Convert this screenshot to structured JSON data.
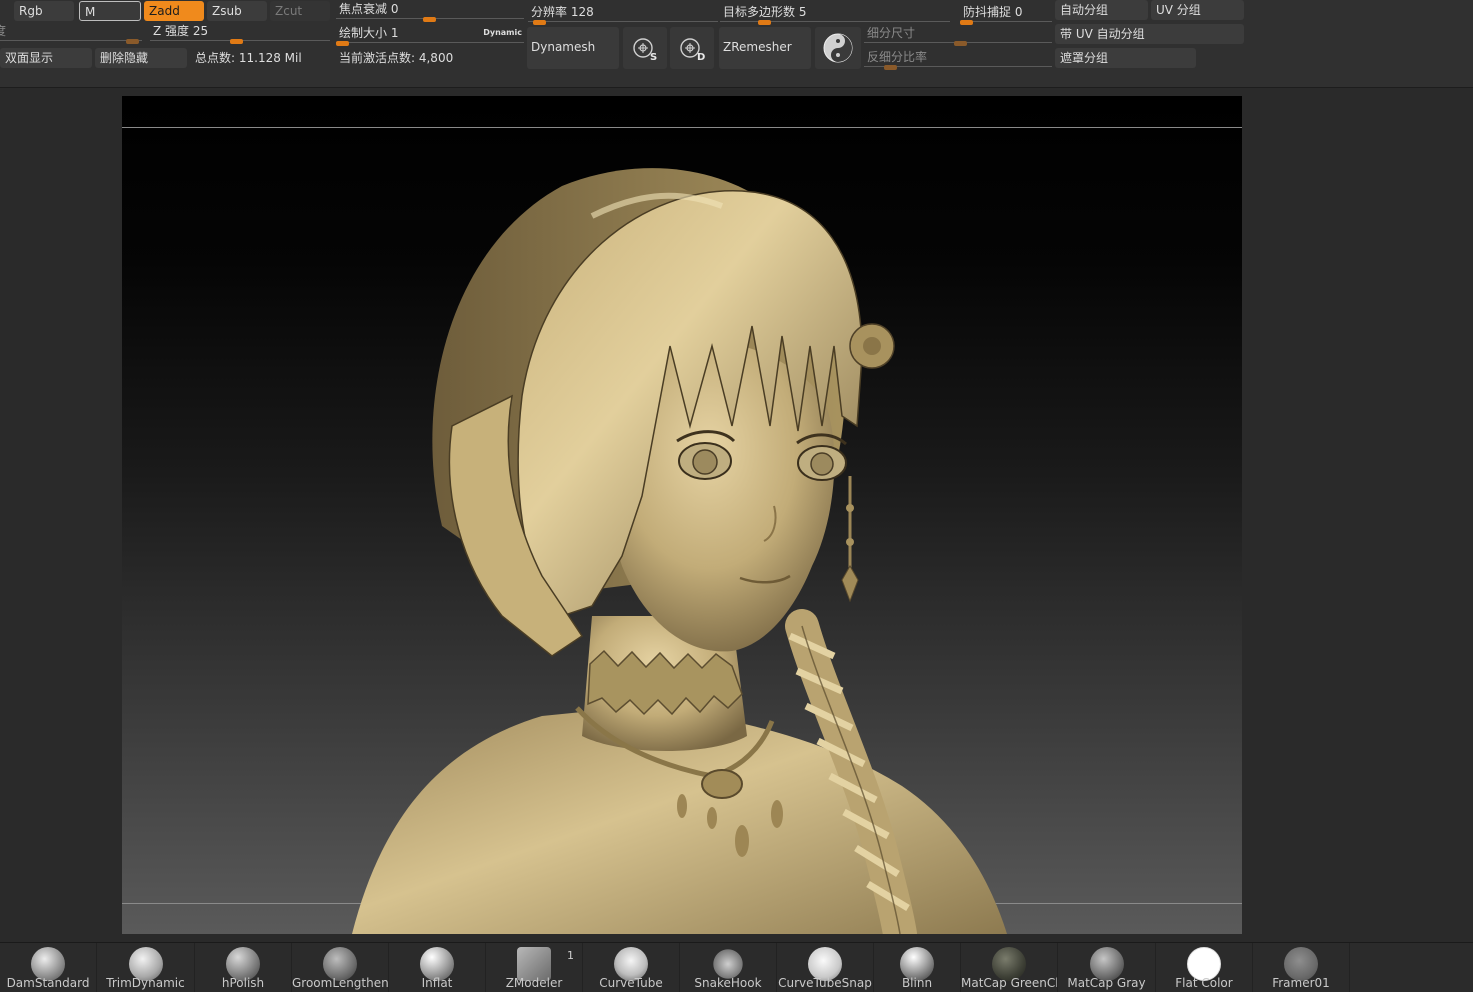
{
  "toolbar": {
    "rgb": "Rgb",
    "m": "M",
    "zadd": "Zadd",
    "zsub": "Zsub",
    "zcut": "Zcut",
    "cut_char": "度",
    "z_intensity": "Z 强度 25",
    "double_sided": "双面显示",
    "delete_hidden": "删除隐藏",
    "total_points": "总点数: 11.128 Mil",
    "focal_shift": "焦点衰减 0",
    "draw_size": "绘制大小 1",
    "dynamic": "Dynamic",
    "active_points": "当前激活点数: 4,800",
    "resolution": "分辨率 128",
    "dynamesh": "Dynamesh",
    "target_polys": "目标多边形数 5",
    "zremesher": "ZRemesher",
    "subdiv_size": "细分尺寸",
    "anti_subdiv_ratio": "反细分比率",
    "stabilize": "防抖捕捉 0",
    "auto_group": "自动分组",
    "uv_group": "UV 分组",
    "auto_group_uv": "带 UV 自动分组",
    "mask_group": "遮罩分组",
    "icon_s_letter": "S",
    "icon_d_letter": "D"
  },
  "colors": {
    "accent": "#f08a1c",
    "panel": "#303030",
    "button": "#3c3c3c",
    "skin": "#cbb582",
    "hair": "#d6c08a"
  },
  "tray": [
    {
      "name": "DamStandard",
      "icon": "dam-standard-brush-icon",
      "badge": ""
    },
    {
      "name": "TrimDynamic",
      "icon": "trim-dynamic-brush-icon",
      "badge": ""
    },
    {
      "name": "hPolish",
      "icon": "hpolish-brush-icon",
      "badge": ""
    },
    {
      "name": "GroomLengthen",
      "icon": "groom-lengthen-brush-icon",
      "badge": ""
    },
    {
      "name": "Inflat",
      "icon": "inflat-brush-icon",
      "badge": ""
    },
    {
      "name": "ZModeler",
      "icon": "zmodeler-brush-icon",
      "badge": "1"
    },
    {
      "name": "CurveTube",
      "icon": "curve-tube-brush-icon",
      "badge": ""
    },
    {
      "name": "SnakeHook",
      "icon": "snake-hook-brush-icon",
      "badge": ""
    },
    {
      "name": "CurveTubeSnap",
      "icon": "curve-tube-snap-brush-icon",
      "badge": ""
    },
    {
      "name": "Blinn",
      "icon": "blinn-material-icon",
      "badge": ""
    },
    {
      "name": "MatCap GreenCl",
      "icon": "matcap-greenclay-material-icon",
      "badge": ""
    },
    {
      "name": "MatCap Gray",
      "icon": "matcap-gray-material-icon",
      "badge": ""
    },
    {
      "name": "Flat Color",
      "icon": "flat-color-material-icon",
      "badge": ""
    },
    {
      "name": "Framer01",
      "icon": "framer01-material-icon",
      "badge": ""
    }
  ]
}
